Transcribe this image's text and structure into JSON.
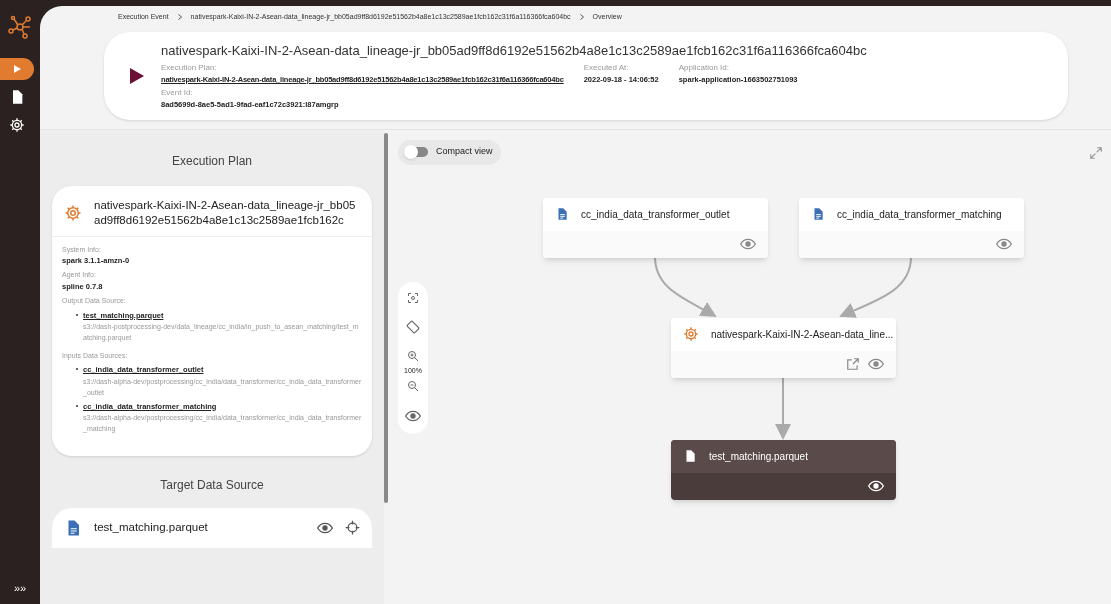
{
  "rail": {
    "items": [
      {
        "kind": "play",
        "selected": true
      },
      {
        "kind": "document",
        "selected": false
      },
      {
        "kind": "gear",
        "selected": false
      }
    ],
    "expand_label": "»»"
  },
  "breadcrumb": [
    "Execution Event",
    "nativespark-Kaixi-IN-2-Asean-data_lineage-jr_bb05ad9ff8d6192e51562b4a8e1c13c2589ae1fcb162c31f6a116366fca604bc",
    "Overview"
  ],
  "header": {
    "title": "nativespark-Kaixi-IN-2-Asean-data_lineage-jr_bb05ad9ff8d6192e51562b4a8e1c13c2589ae1fcb162c31f6a116366fca604bc",
    "fields": [
      {
        "label": "Execution Plan:",
        "value": "nativespark-Kaixi-IN-2-Asean-data_lineage-jr_bb05ad9ff8d6192e51562b4a8e1c13c2589ae1fcb162c31f6a116366fca604bc",
        "kind": "link"
      },
      {
        "label": "Executed At:",
        "value": "2022-09-18 - 14:06:52",
        "kind": "text"
      },
      {
        "label": "Application Id:",
        "value": "spark-application-1663502751093",
        "kind": "text"
      }
    ],
    "event_id": {
      "label": "Event Id:",
      "value": "8ad5699d-8ae5-5ad1-9fad-eaf1c72c3921:l87amgrp"
    }
  },
  "execution_plan": {
    "heading": "Execution Plan",
    "title": "nativespark-Kaixi-IN-2-Asean-data_lineage-jr_bb05ad9ff8d6192e51562b4a8e1c13c2589ae1fcb162c",
    "info": [
      {
        "label": "System Info:",
        "value": "spark 3.1.1-amzn-0"
      },
      {
        "label": "Agent Info:",
        "value": "spline 0.7.8"
      }
    ],
    "source_groups": [
      {
        "label": "Output Data Source:",
        "items": [
          {
            "name": "test_matching.parquet",
            "path": "s3://dash-postprocessing-dev/data_lineage/cc_india/in_push_to_asean_matching/test_matching.parquet"
          }
        ]
      },
      {
        "label": "Inputs Data Sources:",
        "items": [
          {
            "name": "cc_india_data_transformer_outlet",
            "path": "s3://dash-alpha-dev/postprocessing/cc_india/data_transformer/cc_india_data_transformer_outlet"
          },
          {
            "name": "cc_india_data_transformer_matching",
            "path": "s3://dash-alpha-dev/postprocessing/cc_india/data_transformer/cc_india_data_transformer_matching"
          }
        ]
      }
    ]
  },
  "target": {
    "heading": "Target Data Source",
    "name": "test_matching.parquet"
  },
  "graph": {
    "compact_view": {
      "label": "Compact view",
      "on": false
    },
    "zoom": "100%",
    "nodes": [
      {
        "label": "cc_india_data_transformer_outlet",
        "kind": "data_source",
        "selected": false
      },
      {
        "label": "cc_india_data_transformer_matching",
        "kind": "data_source",
        "selected": false
      },
      {
        "label": "nativespark-Kaixi-IN-2-Asean-data_line...",
        "kind": "operation",
        "selected": false
      },
      {
        "label": "test_matching.parquet",
        "kind": "data_source",
        "selected": true
      }
    ]
  }
}
